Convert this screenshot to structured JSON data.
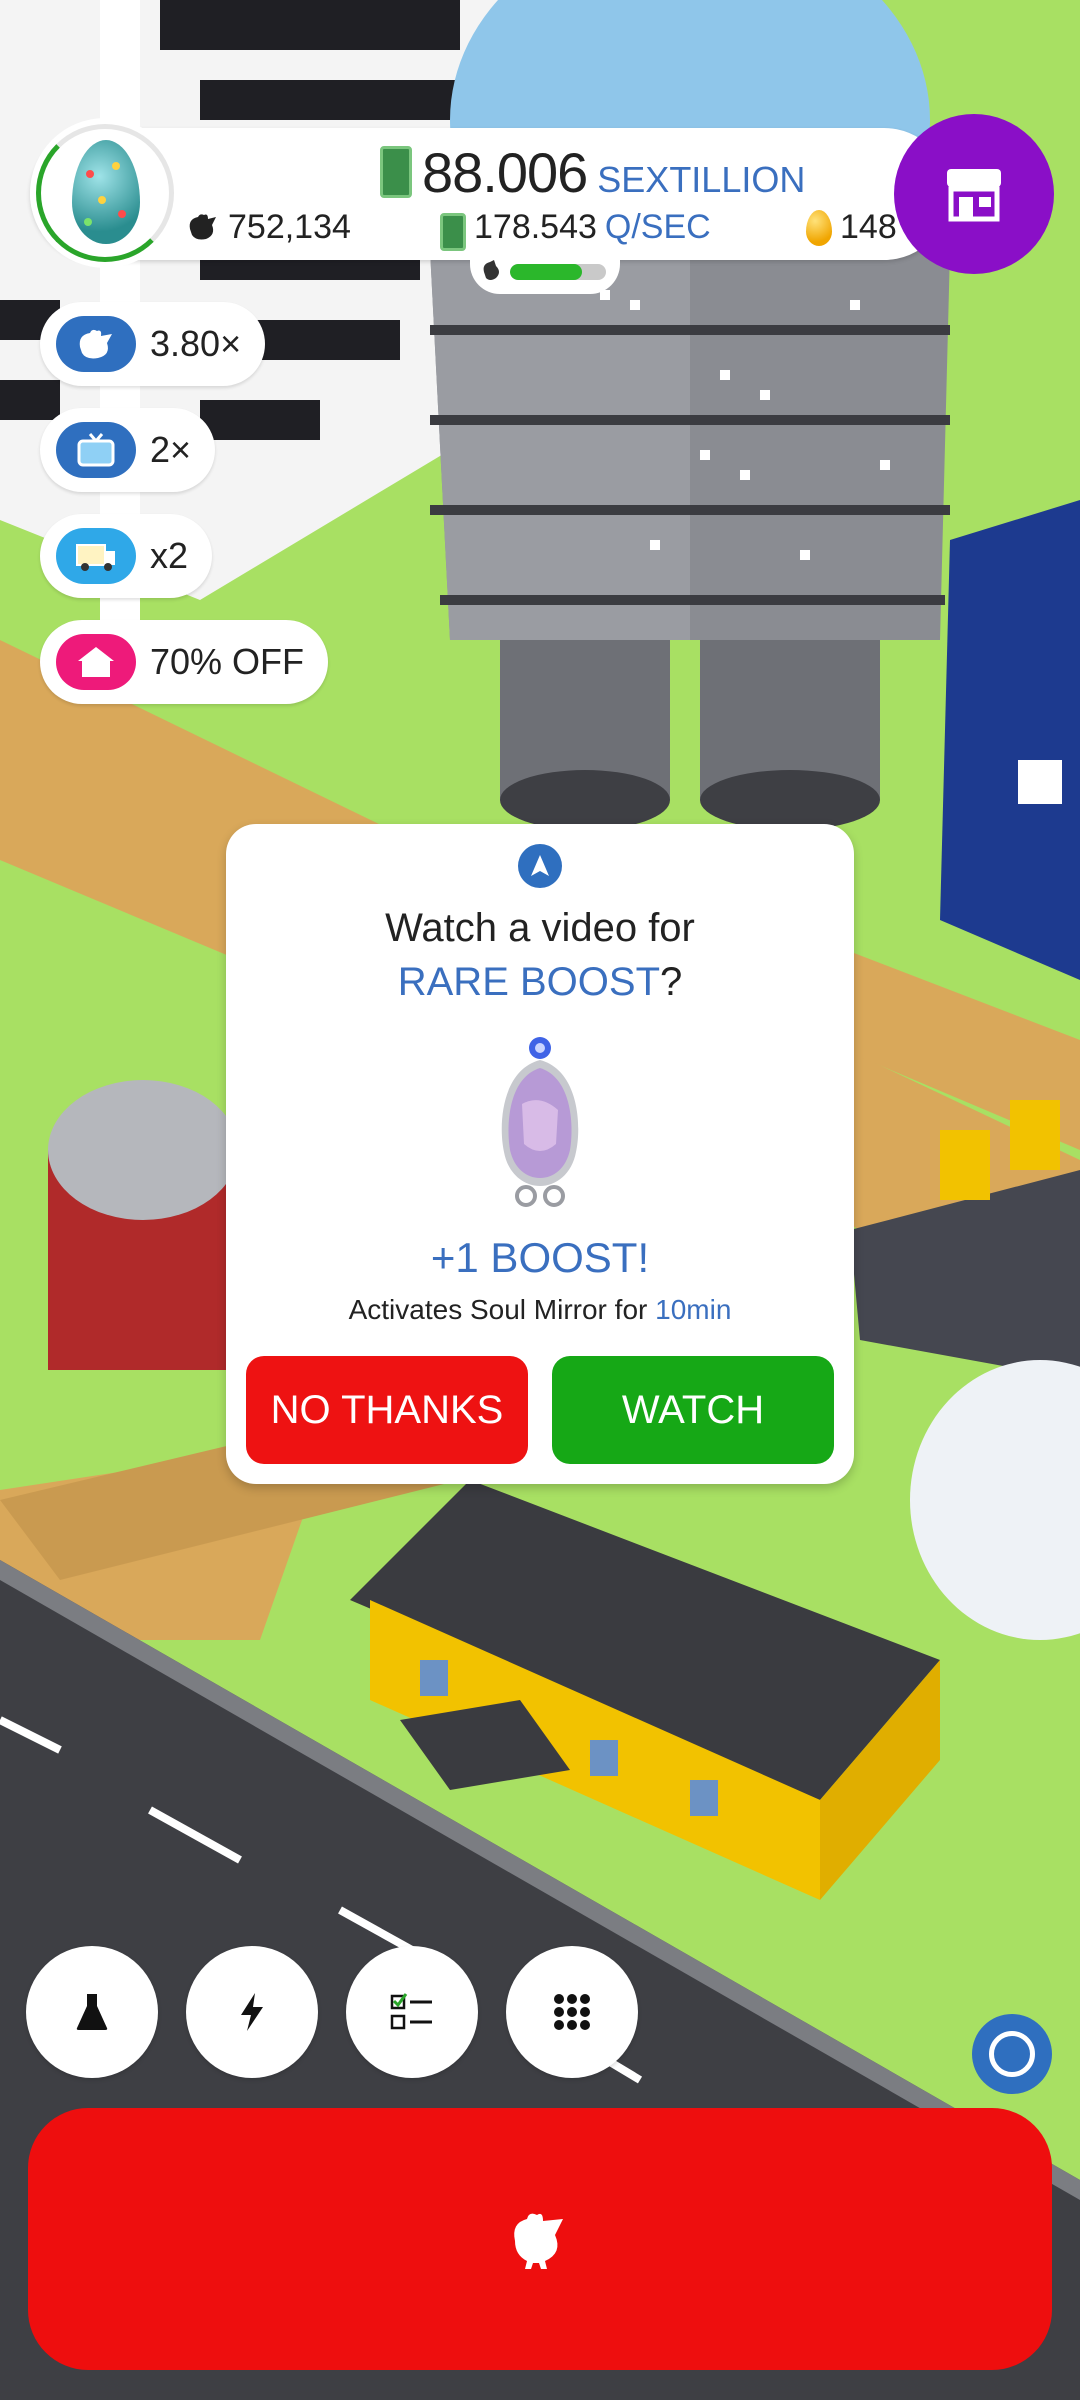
{
  "top_bar": {
    "money_value": "88.006",
    "money_unit": "SEXTILLION",
    "chicken_count": "752,134",
    "income_value": "178.543",
    "income_unit": "Q/SEC",
    "golden_eggs": "148",
    "habitat_progress": 0.75
  },
  "side_buttons": [
    {
      "label": "3.80×",
      "icon": "chicken-icon",
      "color": "#2f6fbf"
    },
    {
      "label": "2×",
      "icon": "tv-icon",
      "color": "#2f6fbf"
    },
    {
      "label": "x2",
      "icon": "video-truck-icon",
      "color": "#2fa8e8"
    },
    {
      "label": "70% OFF",
      "icon": "house-icon",
      "color": "#ee1a7a"
    }
  ],
  "dialog": {
    "title": "Watch a video for",
    "subtitle_highlight": "RARE BOOST",
    "subtitle_suffix": "?",
    "reward": "+1 BOOST!",
    "desc_prefix": "Activates Soul Mirror for ",
    "desc_duration": "10min",
    "no_label": "NO THANKS",
    "watch_label": "WATCH"
  },
  "bottom_nav": [
    {
      "icon": "research-flask-icon"
    },
    {
      "icon": "boost-lightning-icon"
    },
    {
      "icon": "checklist-icon"
    },
    {
      "icon": "menu-grid-icon"
    }
  ],
  "colors": {
    "accent_blue": "#3a6fbf",
    "shop_purple": "#8a0fc7",
    "hatch_red": "#ee0e0e",
    "watch_green": "#16a816",
    "no_red": "#ee1212"
  }
}
